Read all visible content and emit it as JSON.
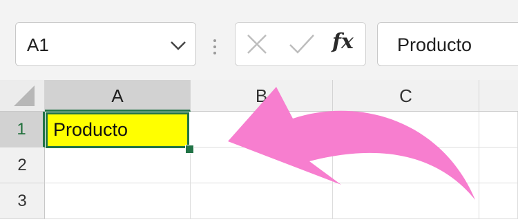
{
  "formula_bar": {
    "name_box_value": "A1",
    "fx_label": "fx",
    "formula_value": "Producto"
  },
  "columns": [
    "A",
    "B",
    "C"
  ],
  "rows": [
    "1",
    "2",
    "3"
  ],
  "cells": {
    "A1": "Producto"
  },
  "colors": {
    "selection_border": "#217346",
    "cell_fill": "#ffff00",
    "annotation_arrow": "#f77ecf"
  },
  "icons": {
    "name_box_dropdown": "chevron-down-icon",
    "more": "vertical-dots-icon",
    "cancel": "x-icon",
    "enter": "check-icon",
    "select_all": "select-all-triangle-icon",
    "annotation": "curved-arrow-icon"
  }
}
